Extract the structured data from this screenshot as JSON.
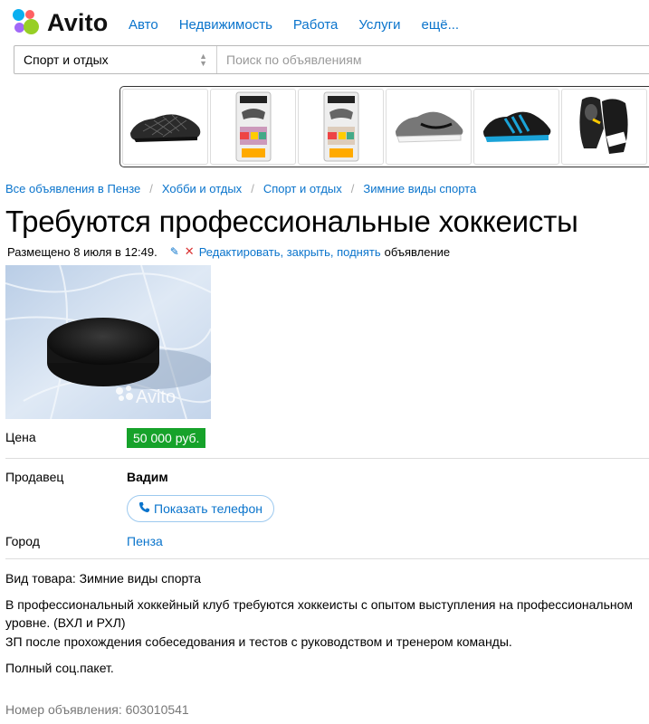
{
  "header": {
    "logo_text": "Avito",
    "nav": [
      "Авто",
      "Недвижимость",
      "Работа",
      "Услуги",
      "ещё..."
    ]
  },
  "search": {
    "category": "Спорт и отдых",
    "placeholder": "Поиск по объявлениям"
  },
  "banner": {
    "items": [
      "black-mesh-shoe-icon",
      "mouthguard-package-icon",
      "mouthguard-package-icon",
      "grey-sneaker-icon",
      "blue-sneaker-icon",
      "boxing-gloves-icon"
    ]
  },
  "breadcrumbs": [
    "Все объявления в Пензе",
    "Хобби и отдых",
    "Спорт и отдых",
    "Зимние виды спорта"
  ],
  "ad": {
    "title": "Требуются профессиональные хоккеисты",
    "posted": "Размещено 8 июля в 12:49.",
    "edit_link": "Редактировать, закрыть, поднять",
    "edit_tail": "объявление",
    "photo_watermark": "Avito",
    "price_label": "Цена",
    "price": "50 000 руб.",
    "seller_label": "Продавец",
    "seller_name": "Вадим",
    "phone_button": "Показать телефон",
    "city_label": "Город",
    "city": "Пенза",
    "category_line": "Вид товара: Зимние виды спорта",
    "description_1": "В профессиональный хоккейный клуб требуются хоккеисты с опытом выступления на профессиональном уровне. (ВХЛ и РХЛ)",
    "description_2": "ЗП после прохождения собеседования и тестов с руководством и тренером команды.",
    "description_3": "Полный соц.пакет.",
    "ad_number": "Номер объявления: 603010541"
  },
  "colors": {
    "link": "#0a74cc",
    "price_bg": "#16a22a",
    "logo_dots": [
      "#97cf26",
      "#0aaff0",
      "#ff6163",
      "#a169f7"
    ]
  }
}
